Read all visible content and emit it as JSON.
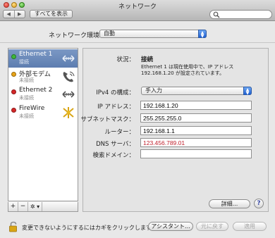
{
  "window": {
    "title": "ネットワーク"
  },
  "toolbar": {
    "back": "◀",
    "forward": "▶",
    "show_all": "すべてを表示",
    "search_placeholder": ""
  },
  "location": {
    "label": "ネットワーク環境：",
    "value": "自動"
  },
  "sidebar": {
    "items": [
      {
        "name": "Ethernet 1",
        "status": "接続",
        "dot_color": "#3db83a",
        "icon": "ethernet-icon"
      },
      {
        "name": "外部モデム",
        "status": "未接続",
        "dot_color": "#e8a417",
        "icon": "phone-icon"
      },
      {
        "name": "Ethernet 2",
        "status": "未接続",
        "dot_color": "#d62728",
        "icon": "ethernet-icon"
      },
      {
        "name": "FireWire",
        "status": "未接続",
        "dot_color": "#d62728",
        "icon": "firewire-icon"
      }
    ],
    "add": "+",
    "remove": "−",
    "actions": "✲ ▾"
  },
  "detail": {
    "status_label": "状況：",
    "status_value": "接続",
    "status_desc": "Ethernet 1 は現在使用中で、IP アドレス 192.168.1.20 が設定されています。",
    "ipv4_label": "IPv4 の構成：",
    "ipv4_value": "手入力",
    "ip_label": "IP アドレス：",
    "ip_value": "192.168.1.20",
    "subnet_label": "サブネットマスク：",
    "subnet_value": "255.255.255.0",
    "router_label": "ルーター：",
    "router_value": "192.168.1.1",
    "dns_label": "DNS サーバ：",
    "dns_value": "123.456.789.01",
    "search_domains_label": "検索ドメイン：",
    "search_domains_value": "",
    "advanced_button": "詳細...",
    "help_button": "?"
  },
  "footer": {
    "lock_text": "変更できないようにするにはカギをクリックします。",
    "assistant_button": "アシスタント...",
    "revert_button": "元に戻す",
    "apply_button": "適用"
  },
  "colors": {
    "selection": "#5d7db0",
    "dns_text": "#c0212d",
    "popup_accent": "#1f5fd1"
  }
}
